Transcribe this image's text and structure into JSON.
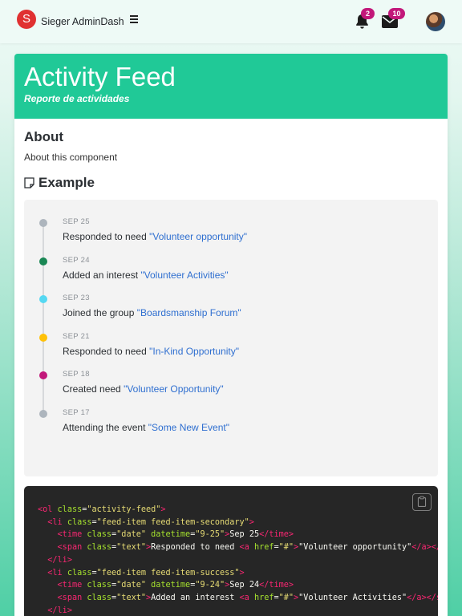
{
  "navbar": {
    "logo_letter": "S",
    "brand": "Sieger AdminDash",
    "notifications_count": "2",
    "messages_count": "10",
    "icons": [
      "bell-icon",
      "envelope-icon",
      "hamburger-icon",
      "avatar"
    ]
  },
  "card": {
    "title": "Activity Feed",
    "subtitle": "Reporte de actividades",
    "about_heading": "About",
    "about_text": "About this component",
    "example_heading": "Example"
  },
  "feed": [
    {
      "date": "SEP 25",
      "text": "Responded to need ",
      "link": "\"Volunteer opportunity\"",
      "color": "#adb5bd"
    },
    {
      "date": "SEP 24",
      "text": "Added an interest ",
      "link": "\"Volunteer Activities\"",
      "color": "#198754"
    },
    {
      "date": "SEP 23",
      "text": "Joined the group ",
      "link": "\"Boardsmanship Forum\"",
      "color": "#55d8f2"
    },
    {
      "date": "SEP 21",
      "text": "Responded to need ",
      "link": "\"In-Kind Opportunity\"",
      "color": "#ffc107"
    },
    {
      "date": "SEP 18",
      "text": "Created need ",
      "link": "\"Volunteer Opportunity\"",
      "color": "#c2187a"
    },
    {
      "date": "SEP 17",
      "text": "Attending the event ",
      "link": "\"Some New Event\"",
      "color": "#adb5bd"
    }
  ],
  "code": {
    "lines": [
      [
        [
          "t",
          "<ol "
        ],
        [
          "a",
          "class"
        ],
        [
          "p",
          "="
        ],
        [
          "s",
          "\"activity-feed\""
        ],
        [
          "t",
          ">"
        ]
      ],
      [
        [
          "p",
          "  "
        ],
        [
          "t",
          "<li "
        ],
        [
          "a",
          "class"
        ],
        [
          "p",
          "="
        ],
        [
          "s",
          "\"feed-item feed-item-secondary\""
        ],
        [
          "t",
          ">"
        ]
      ],
      [
        [
          "p",
          "    "
        ],
        [
          "t",
          "<time "
        ],
        [
          "a",
          "class"
        ],
        [
          "p",
          "="
        ],
        [
          "s",
          "\"date\" "
        ],
        [
          "a",
          "datetime"
        ],
        [
          "p",
          "="
        ],
        [
          "s",
          "\"9-25\""
        ],
        [
          "t",
          ">"
        ],
        [
          "p",
          "Sep 25"
        ],
        [
          "t",
          "</time>"
        ]
      ],
      [
        [
          "p",
          "    "
        ],
        [
          "t",
          "<span "
        ],
        [
          "a",
          "class"
        ],
        [
          "p",
          "="
        ],
        [
          "s",
          "\"text\""
        ],
        [
          "t",
          ">"
        ],
        [
          "p",
          "Responded to need "
        ],
        [
          "t",
          "<a "
        ],
        [
          "a",
          "href"
        ],
        [
          "p",
          "="
        ],
        [
          "s",
          "\"#\""
        ],
        [
          "t",
          ">"
        ],
        [
          "p",
          "\"Volunteer opportunity\""
        ],
        [
          "t",
          "</a></span>"
        ]
      ],
      [
        [
          "p",
          "  "
        ],
        [
          "t",
          "</li>"
        ]
      ],
      [
        [
          "p",
          "  "
        ],
        [
          "t",
          "<li "
        ],
        [
          "a",
          "class"
        ],
        [
          "p",
          "="
        ],
        [
          "s",
          "\"feed-item feed-item-success\""
        ],
        [
          "t",
          ">"
        ]
      ],
      [
        [
          "p",
          "    "
        ],
        [
          "t",
          "<time "
        ],
        [
          "a",
          "class"
        ],
        [
          "p",
          "="
        ],
        [
          "s",
          "\"date\" "
        ],
        [
          "a",
          "datetime"
        ],
        [
          "p",
          "="
        ],
        [
          "s",
          "\"9-24\""
        ],
        [
          "t",
          ">"
        ],
        [
          "p",
          "Sep 24"
        ],
        [
          "t",
          "</time>"
        ]
      ],
      [
        [
          "p",
          "    "
        ],
        [
          "t",
          "<span "
        ],
        [
          "a",
          "class"
        ],
        [
          "p",
          "="
        ],
        [
          "s",
          "\"text\""
        ],
        [
          "t",
          ">"
        ],
        [
          "p",
          "Added an interest "
        ],
        [
          "t",
          "<a "
        ],
        [
          "a",
          "href"
        ],
        [
          "p",
          "="
        ],
        [
          "s",
          "\"#\""
        ],
        [
          "t",
          ">"
        ],
        [
          "p",
          "\"Volunteer Activities\""
        ],
        [
          "t",
          "</a></span>"
        ]
      ],
      [
        [
          "p",
          "  "
        ],
        [
          "t",
          "</li>"
        ]
      ]
    ]
  },
  "colors": {
    "header": "#20c997",
    "badge": "#c2187a",
    "link": "#2f6fd0",
    "code_bg": "#262626"
  }
}
